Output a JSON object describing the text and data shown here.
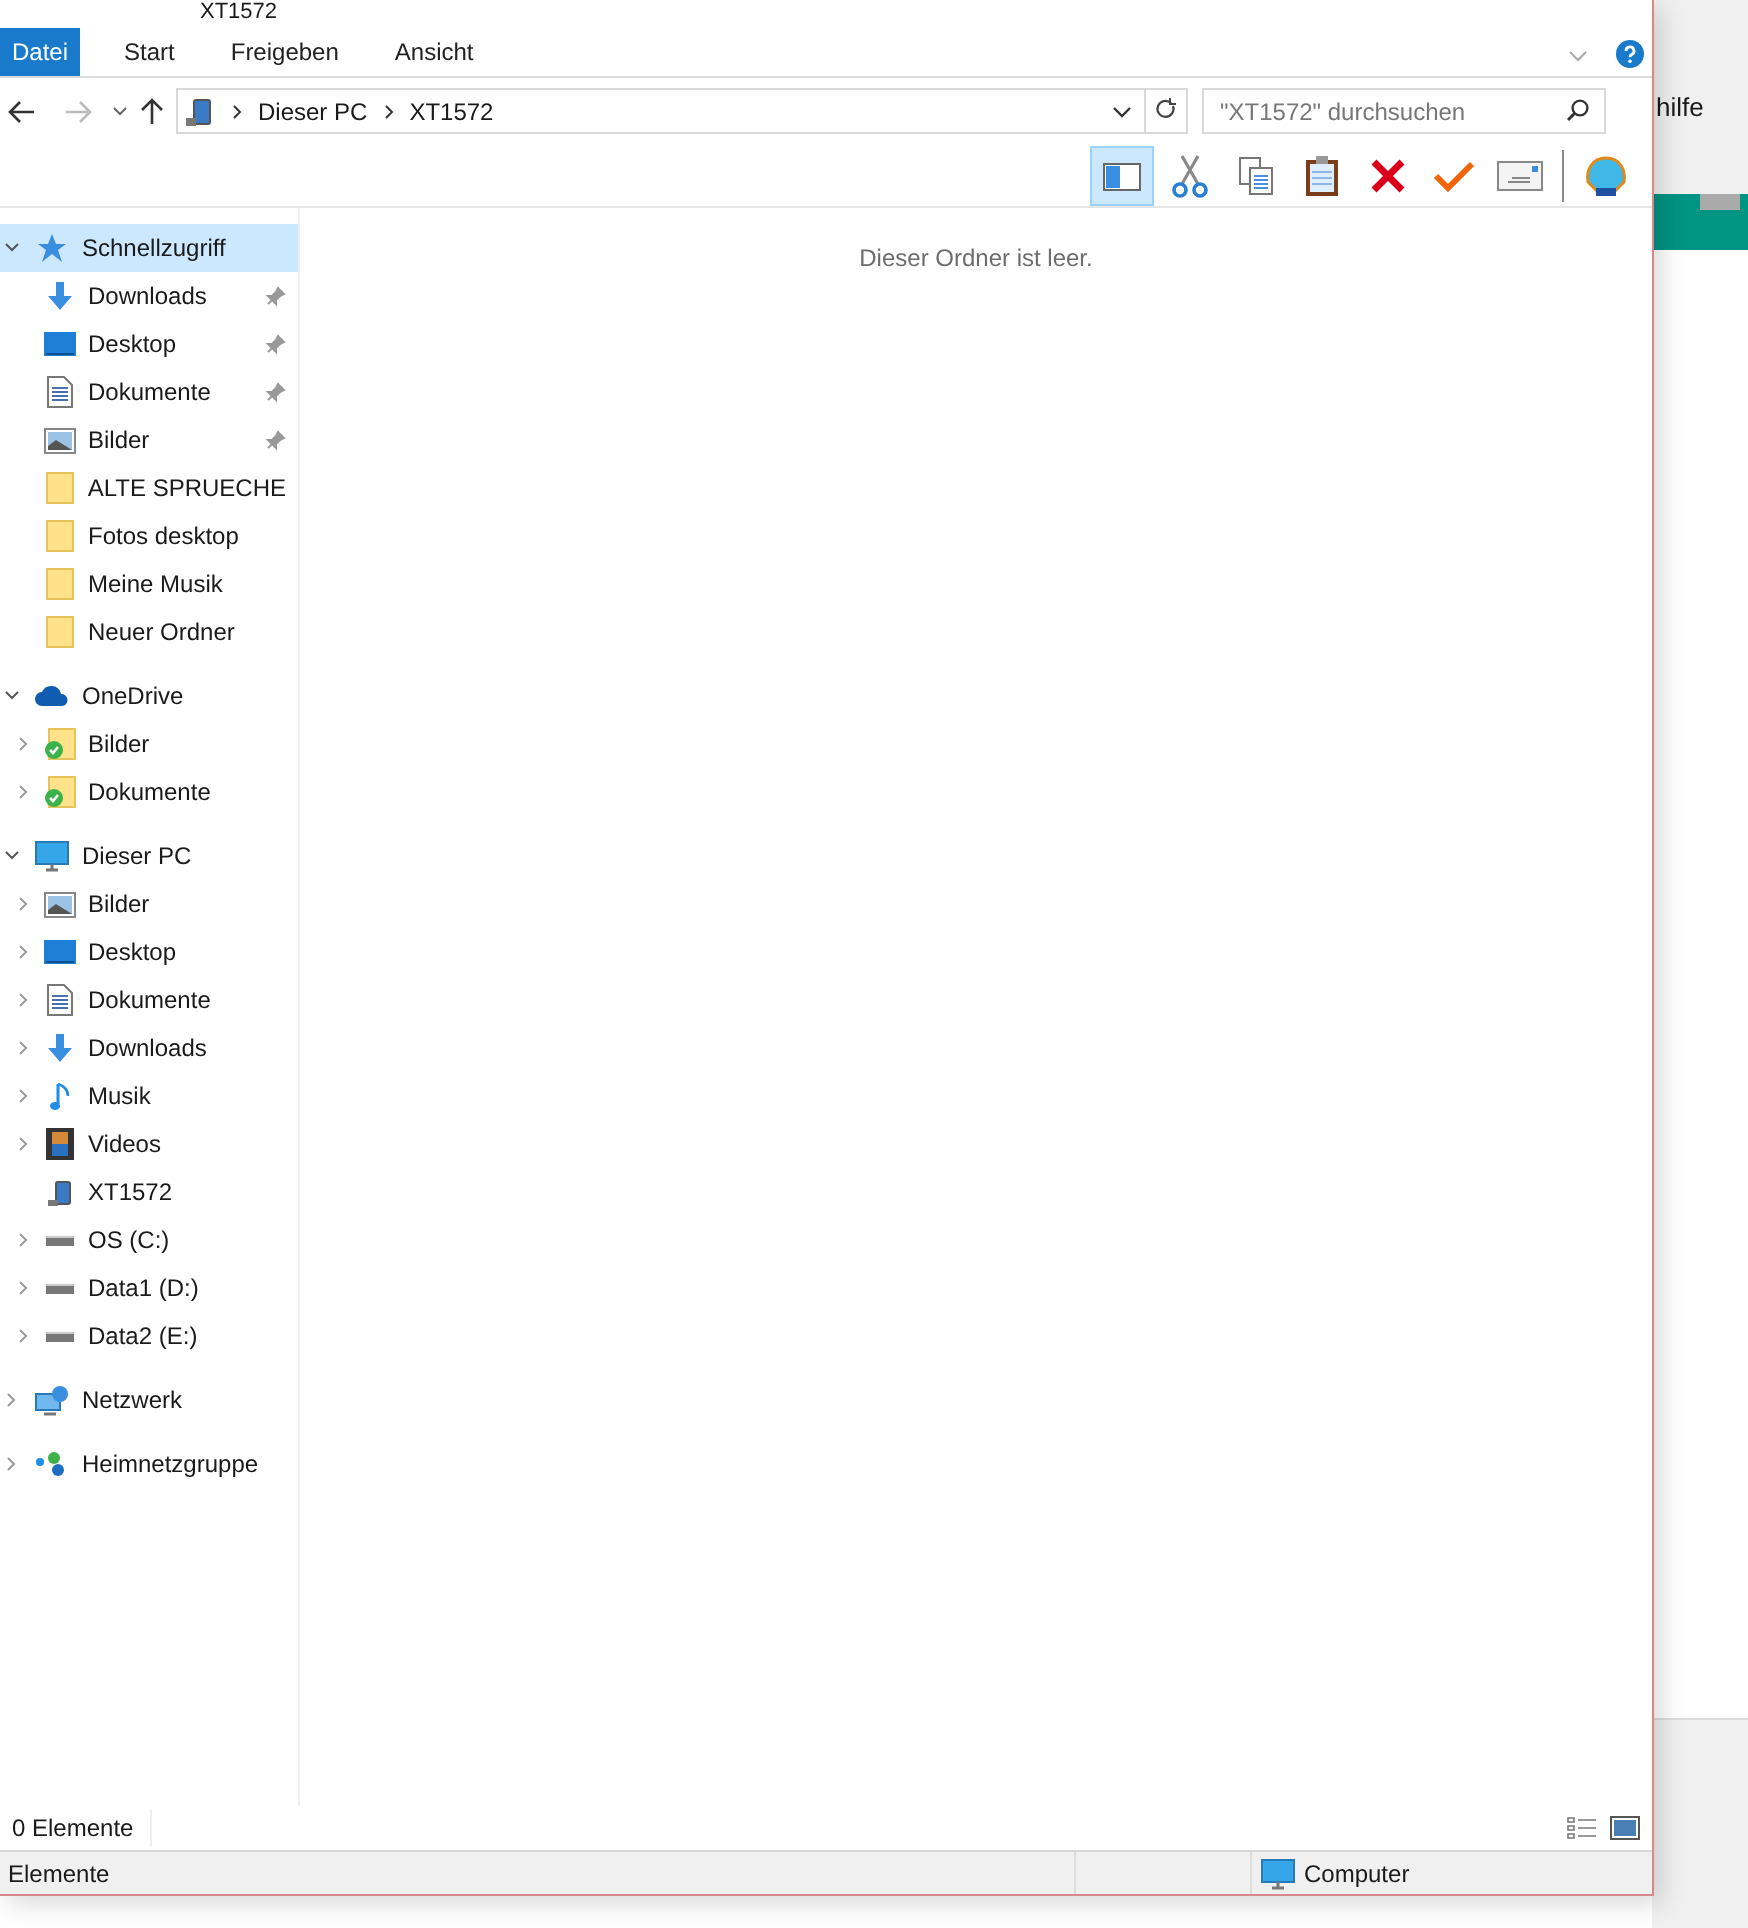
{
  "window": {
    "title": "XT1572"
  },
  "ribbon_tabs": [
    {
      "label": "Datei",
      "selected": true
    },
    {
      "label": "Start",
      "selected": false
    },
    {
      "label": "Freigeben",
      "selected": false
    },
    {
      "label": "Ansicht",
      "selected": false
    }
  ],
  "address_bar": {
    "segments": [
      "Dieser PC",
      "XT1572"
    ]
  },
  "search": {
    "placeholder": "\"XT1572\" durchsuchen"
  },
  "toolbar": [
    {
      "kind": "pane",
      "on": true
    },
    {
      "kind": "cut"
    },
    {
      "kind": "copy"
    },
    {
      "kind": "paste"
    },
    {
      "kind": "delete"
    },
    {
      "kind": "check"
    },
    {
      "kind": "mail"
    },
    {
      "kind": "separator"
    },
    {
      "kind": "shell"
    }
  ],
  "navigation": [
    {
      "label": "Schnellzugriff",
      "kind": "star",
      "expanded": true,
      "selected": true,
      "children": [
        {
          "label": "Downloads",
          "kind": "download",
          "pinned": true,
          "expandable": false
        },
        {
          "label": "Desktop",
          "kind": "desktop",
          "pinned": true,
          "expandable": false
        },
        {
          "label": "Dokumente",
          "kind": "document",
          "pinned": true,
          "expandable": false
        },
        {
          "label": "Bilder",
          "kind": "pictures",
          "pinned": true,
          "expandable": false
        },
        {
          "label": "ALTE SPRUECHE",
          "kind": "folder",
          "pinned": false,
          "expandable": false
        },
        {
          "label": "Fotos desktop",
          "kind": "folder",
          "pinned": false,
          "expandable": false
        },
        {
          "label": "Meine Musik",
          "kind": "folder",
          "pinned": false,
          "expandable": false
        },
        {
          "label": "Neuer Ordner",
          "kind": "folder",
          "pinned": false,
          "expandable": false
        }
      ]
    },
    {
      "label": "OneDrive",
      "kind": "cloud",
      "expanded": true,
      "selected": false,
      "children": [
        {
          "label": "Bilder",
          "kind": "synced",
          "pinned": false,
          "expandable": true
        },
        {
          "label": "Dokumente",
          "kind": "synced",
          "pinned": false,
          "expandable": true
        }
      ]
    },
    {
      "label": "Dieser PC",
      "kind": "pc",
      "expanded": true,
      "selected": false,
      "children": [
        {
          "label": "Bilder",
          "kind": "pictures",
          "pinned": false,
          "expandable": true
        },
        {
          "label": "Desktop",
          "kind": "desktop",
          "pinned": false,
          "expandable": true
        },
        {
          "label": "Dokumente",
          "kind": "document",
          "pinned": false,
          "expandable": true
        },
        {
          "label": "Downloads",
          "kind": "download",
          "pinned": false,
          "expandable": true
        },
        {
          "label": "Musik",
          "kind": "music",
          "pinned": false,
          "expandable": true
        },
        {
          "label": "Videos",
          "kind": "video",
          "pinned": false,
          "expandable": true
        },
        {
          "label": "XT1572",
          "kind": "phone",
          "pinned": false,
          "expandable": false
        },
        {
          "label": "OS (C:)",
          "kind": "drive",
          "pinned": false,
          "expandable": true
        },
        {
          "label": "Data1 (D:)",
          "kind": "drive",
          "pinned": false,
          "expandable": true
        },
        {
          "label": "Data2 (E:)",
          "kind": "drive",
          "pinned": false,
          "expandable": true
        }
      ]
    },
    {
      "label": "Netzwerk",
      "kind": "network",
      "expanded": false,
      "selected": false
    },
    {
      "label": "Heimnetzgruppe",
      "kind": "homegroup",
      "expanded": false,
      "selected": false
    }
  ],
  "content": {
    "empty_message": "Dieser Ordner ist leer."
  },
  "status": {
    "count": "0 Elemente"
  },
  "bottom_bar": {
    "left": "Elemente",
    "right": "Computer"
  },
  "background_window": {
    "text": "hilfe"
  }
}
